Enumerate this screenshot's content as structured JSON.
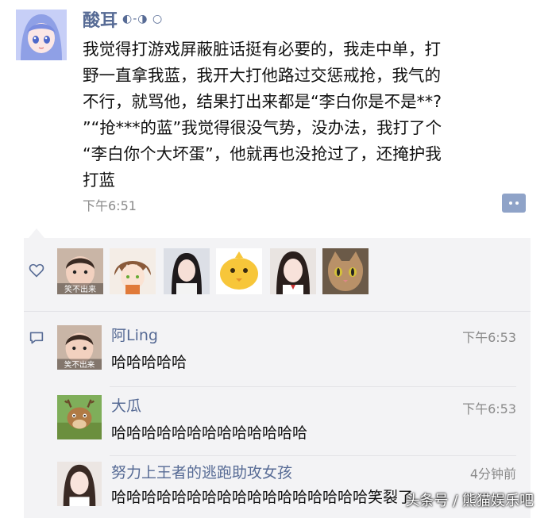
{
  "post": {
    "author": "酸耳",
    "author_deco": "◐-◑ ○",
    "text": "我觉得打游戏屏蔽脏话挺有必要的，我走中单，打\n野一直拿我蓝，我开大打他路过交惩戒抢，我气的\n不行，就骂他，结果打出来都是“李白你是不是**?\n”“抢***的蓝”我觉得很没气势，没办法，我打了个\n“李白你个大坏蛋”，他就再也没抢过了，还掩护我\n打蓝",
    "time": "下午6:51",
    "comment_button_icon": "comment-dots-icon"
  },
  "likes": {
    "icon": "heart-outline-icon",
    "avatars": [
      {
        "name": "like-avatar-child",
        "caption": "笑不出来"
      },
      {
        "name": "like-avatar-anime",
        "caption": ""
      },
      {
        "name": "like-avatar-girl-1",
        "caption": ""
      },
      {
        "name": "like-avatar-chick",
        "caption": ""
      },
      {
        "name": "like-avatar-girl-2",
        "caption": ""
      },
      {
        "name": "like-avatar-cat",
        "caption": ""
      }
    ]
  },
  "comments_icon": "comment-bubble-icon",
  "comments": [
    {
      "name": "阿Ling",
      "time": "下午6:53",
      "text": "哈哈哈哈哈",
      "avatar_caption": "笑不出来"
    },
    {
      "name": "大瓜",
      "time": "下午6:53",
      "text": "哈哈哈哈哈哈哈哈哈哈哈哈哈",
      "avatar_caption": ""
    },
    {
      "name": "努力上王者的逃跑助攻女孩",
      "time": "4分钟前",
      "text": "哈哈哈哈哈哈哈哈哈哈哈哈哈哈哈哈哈笑裂了",
      "avatar_caption": ""
    }
  ],
  "watermark": "头条号 / 熊猫娱乐吧",
  "colors": {
    "name_link": "#576b95",
    "panel_bg": "#f3f3f5",
    "time_gray": "#8a8a8a"
  }
}
